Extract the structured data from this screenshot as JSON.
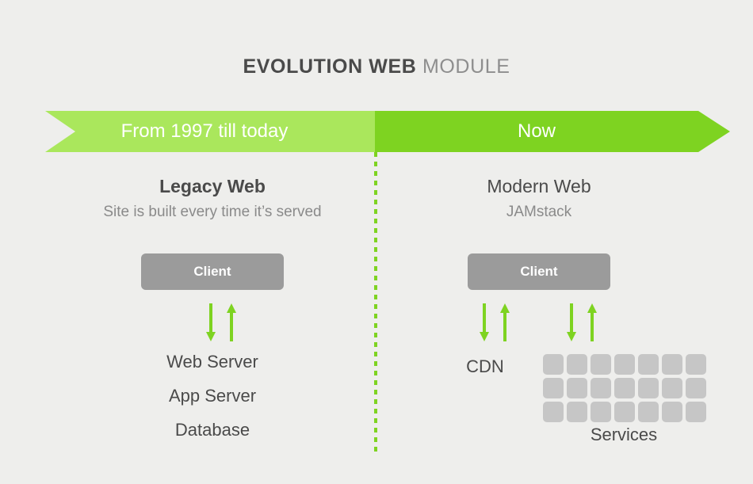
{
  "title": {
    "strong": "EVOLUTION WEB",
    "light": "MODULE"
  },
  "banner": {
    "left_label": "From 1997 till today",
    "right_label": "Now",
    "left_color": "#aae75c",
    "right_color": "#7ed321"
  },
  "divider": {
    "color": "#7ed321",
    "style": "dotted-vertical"
  },
  "left_column": {
    "heading": "Legacy Web",
    "subheading": "Site is built every time it’s served",
    "client_box": {
      "label": "Client",
      "color": "#9b9b9b"
    },
    "arrows": [
      {
        "direction": "down",
        "color": "#7ed321"
      },
      {
        "direction": "up",
        "color": "#7ed321"
      }
    ],
    "stack": [
      "Web Server",
      "App Server",
      "Database"
    ]
  },
  "right_column": {
    "heading": "Modern Web",
    "subheading": "JAMstack",
    "client_box": {
      "label": "Client",
      "color": "#9b9b9b"
    },
    "arrows_cdn": [
      {
        "direction": "down",
        "color": "#7ed321"
      },
      {
        "direction": "up",
        "color": "#7ed321"
      }
    ],
    "arrows_services": [
      {
        "direction": "down",
        "color": "#7ed321"
      },
      {
        "direction": "up",
        "color": "#7ed321"
      }
    ],
    "cdn_label": "CDN",
    "services_label": "Services",
    "services_grid": {
      "rows": 3,
      "columns": 7,
      "cell_color": "#c6c6c6"
    }
  },
  "background_color": "#eeeeec",
  "text_color": "#4a4a4a"
}
